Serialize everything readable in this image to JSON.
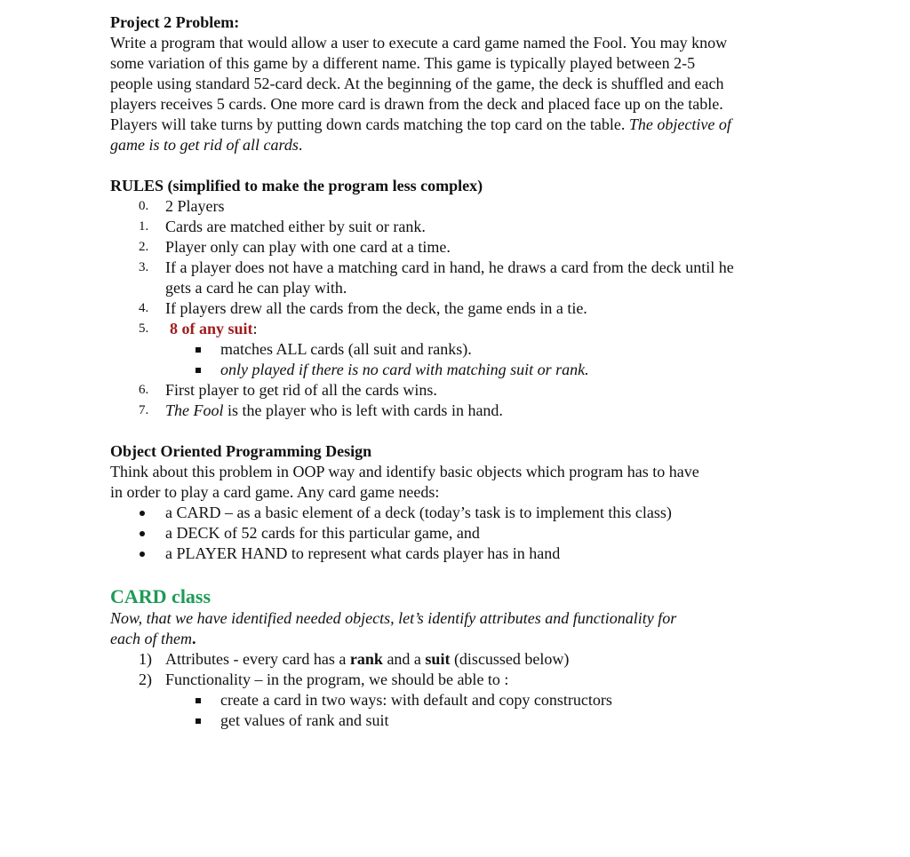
{
  "intro": {
    "title": "Project 2 Problem:",
    "lines": [
      "Write a program that would allow a user to execute a card game named the Fool. You may know",
      "some variation of this game by a different name. This game is typically played between 2-5",
      "people using standard 52-card deck. At the beginning of the game, the deck is shuffled and each",
      "players receives 5 cards. One more card is drawn from the deck and placed face up on the table.",
      "Players will take turns by putting down cards matching the top card on the table. "
    ],
    "objective_part1": "The objective of",
    "objective_part2": "game is to get rid of all cards",
    "objective_end": "."
  },
  "rules": {
    "title": "RULES (simplified to make the program less complex)",
    "items": [
      {
        "num": "0.",
        "text": "2 Players"
      },
      {
        "num": "1.",
        "text": "Cards are matched either by suit or rank."
      },
      {
        "num": "2.",
        "text": "Player only can play with one card at a time."
      },
      {
        "num": "3.",
        "text": "If a player does not have a matching card in hand, he draws a card from the deck until he",
        "cont": "gets a card he can play with."
      },
      {
        "num": "4.",
        "text": "If players drew all the cards from the deck, the game ends in a tie."
      },
      {
        "num": "5.",
        "highlight": "8 of any suit",
        "after": ":"
      },
      {
        "num": "6.",
        "text": "First player to get rid of all the cards wins."
      },
      {
        "num": "7.",
        "italic": "The Fool",
        "text": " is the player who is left with cards in hand."
      }
    ],
    "eight_sub": [
      "matches ALL cards (all suit and ranks).",
      "only played if there is no card with matching suit or rank."
    ]
  },
  "oop": {
    "title": "Object Oriented Programming Design",
    "lines": [
      "Think about this problem in OOP way and identify basic objects which program has to have",
      "in order to play a card game. Any card game needs:"
    ],
    "bullets": [
      "a CARD – as a basic element of a deck (today’s task is to implement this class)",
      "a DECK of 52 cards for this particular game, and",
      "a PLAYER HAND to represent what cards player has in hand"
    ]
  },
  "card_class": {
    "title": "CARD class",
    "intro_line1": "Now, that we have identified needed objects, let’s identify attributes and functionality for",
    "intro_line2": "each of them",
    "intro_end": ".",
    "items": [
      {
        "num": "1)",
        "pre": "Attributes - every card has a ",
        "b1": "rank",
        "mid": " and a ",
        "b2": "suit",
        "post": " (discussed below)"
      },
      {
        "num": "2)",
        "text": "Functionality – in the program, we should be able to :"
      }
    ],
    "func_sub": [
      "create a card in two ways: with default and copy constructors",
      "get values of rank and suit"
    ]
  },
  "colors": {
    "highlight_red": "#a01c1c",
    "heading_green": "#1f9a55"
  }
}
